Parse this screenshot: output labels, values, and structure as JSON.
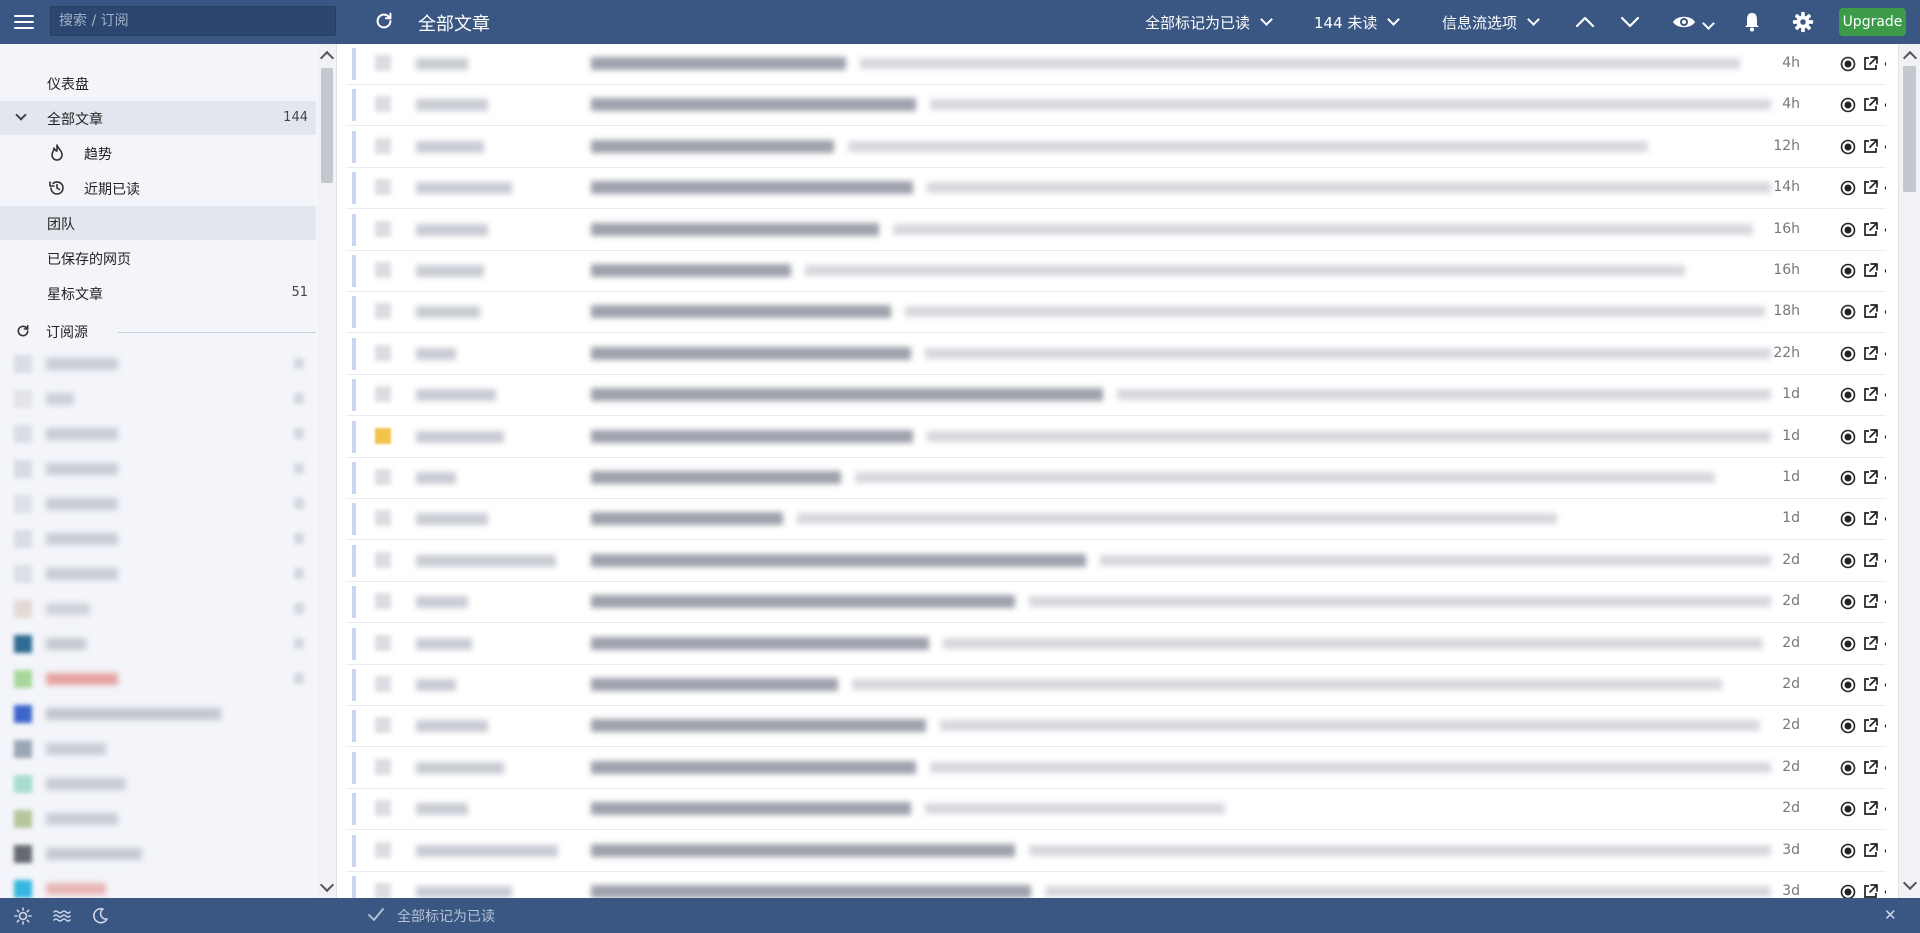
{
  "topbar": {
    "search_placeholder": "搜索 / 订阅",
    "title": "全部文章",
    "mark_all_read": "全部标记为已读",
    "unread": "144 未读",
    "feed_options": "信息流选项",
    "upgrade": "Upgrade"
  },
  "sidebar": {
    "dashboard": "仪表盘",
    "all_articles": "全部文章",
    "all_articles_count": "144",
    "trending": "趋势",
    "recently_read": "近期已读",
    "team": "团队",
    "saved_pages": "已保存的网页",
    "starred": "星标文章",
    "starred_count": "51",
    "subscriptions": "订阅源"
  },
  "articles": [
    {
      "age": "4h",
      "starred": false
    },
    {
      "age": "4h",
      "starred": false
    },
    {
      "age": "12h",
      "starred": false
    },
    {
      "age": "14h",
      "starred": false
    },
    {
      "age": "16h",
      "starred": false
    },
    {
      "age": "16h",
      "starred": false
    },
    {
      "age": "18h",
      "starred": false
    },
    {
      "age": "22h",
      "starred": false
    },
    {
      "age": "1d",
      "starred": false
    },
    {
      "age": "1d",
      "starred": true
    },
    {
      "age": "1d",
      "starred": false
    },
    {
      "age": "1d",
      "starred": false
    },
    {
      "age": "2d",
      "starred": false
    },
    {
      "age": "2d",
      "starred": false
    },
    {
      "age": "2d",
      "starred": false
    },
    {
      "age": "2d",
      "starred": false
    },
    {
      "age": "2d",
      "starred": false
    },
    {
      "age": "2d",
      "starred": false
    },
    {
      "age": "2d",
      "starred": false
    },
    {
      "age": "3d",
      "starred": false
    },
    {
      "age": "3d",
      "starred": false
    }
  ],
  "bottombar": {
    "mark_all_read": "全部标记为已读"
  },
  "colors": {
    "topbar": "#3a5683",
    "upgrade": "#3c9b48",
    "sidebar": "#f3f5fa",
    "unread_bar": "#c9d6f1"
  }
}
